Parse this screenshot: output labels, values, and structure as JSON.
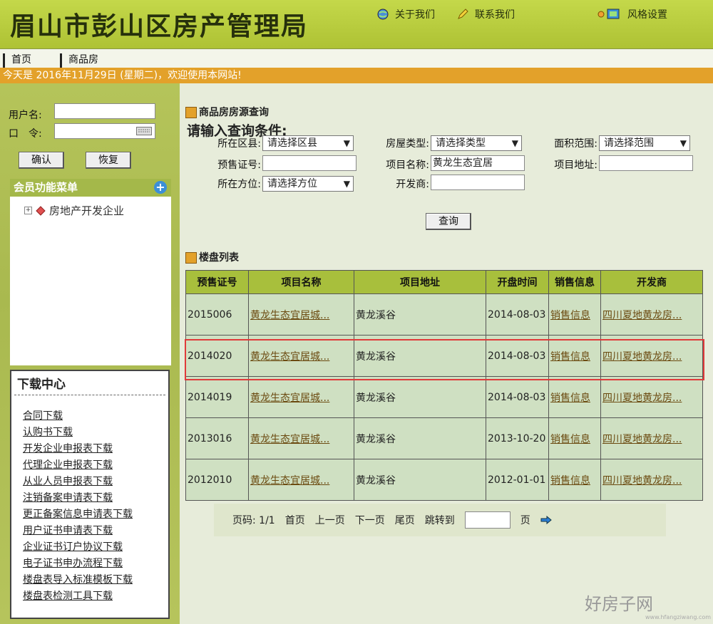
{
  "header": {
    "site_title": "眉山市彭山区房产管理局",
    "about": "关于我们",
    "contact": "联系我们",
    "style": "风格设置"
  },
  "nav": {
    "home": "首页",
    "commercial": "商品房"
  },
  "datebar": "今天是 2016年11月29日 (星期二)，欢迎使用本网站!",
  "login": {
    "username_label": "用户名:",
    "password_label": "口　令:",
    "confirm": "确认",
    "reset": "恢复"
  },
  "member": {
    "title": "会员功能菜单",
    "item": "房地产开发企业"
  },
  "downloads": {
    "title": "下载中心",
    "items": [
      "合同下载",
      "认购书下载",
      "开发企业申报表下载",
      "代理企业申报表下载",
      "从业人员申报表下载",
      "注销备案申请表下载",
      "更正备案信息申请表下载",
      "用户证书申请表下载",
      "企业证书订户协议下载",
      "电子证书申办流程下载",
      "楼盘表导入标准模板下载",
      "楼盘表检测工具下载"
    ]
  },
  "query": {
    "section_title": "商品房房源查询",
    "prompt": "请输入查询条件:",
    "district_label": "所在区县:",
    "district_value": "请选择区县",
    "type_label": "房屋类型:",
    "type_value": "请选择类型",
    "area_label": "面积范围:",
    "area_value": "请选择范围",
    "presale_label": "预售证号:",
    "presale_value": "",
    "project_label": "项目名称:",
    "project_value": "黄龙生态宜居",
    "address_label": "项目地址:",
    "address_value": "",
    "direction_label": "所在方位:",
    "direction_value": "请选择方位",
    "developer_label": "开发商:",
    "developer_value": "",
    "search_button": "查询"
  },
  "listing": {
    "section_title": "楼盘列表",
    "columns": [
      "预售证号",
      "项目名称",
      "项目地址",
      "开盘时间",
      "销售信息",
      "开发商"
    ],
    "rows": [
      [
        "2015006",
        "黄龙生态宜居城...",
        "黄龙溪谷",
        "2014-08-03",
        "销售信息",
        "四川夏地黄龙房..."
      ],
      [
        "2014020",
        "黄龙生态宜居城...",
        "黄龙溪谷",
        "2014-08-03",
        "销售信息",
        "四川夏地黄龙房..."
      ],
      [
        "2014019",
        "黄龙生态宜居城...",
        "黄龙溪谷",
        "2014-08-03",
        "销售信息",
        "四川夏地黄龙房..."
      ],
      [
        "2013016",
        "黄龙生态宜居城...",
        "黄龙溪谷",
        "2013-10-20",
        "销售信息",
        "四川夏地黄龙房..."
      ],
      [
        "2012010",
        "黄龙生态宜居城...",
        "黄龙溪谷",
        "2012-01-01",
        "销售信息",
        "四川夏地黄龙房..."
      ]
    ],
    "highlighted_row": 1
  },
  "pager": {
    "page_info": "页码: 1/1",
    "first": "首页",
    "prev": "上一页",
    "next": "下一页",
    "last": "尾页",
    "jump": "跳转到",
    "page_suffix": "页"
  },
  "watermark": {
    "text": "好房子网",
    "url": "www.hfangziwang.com"
  },
  "icons": {
    "about": "globe-icon",
    "contact": "pencil-icon",
    "style": "palette-icon",
    "go": "arrow-right-icon"
  },
  "colors": {
    "header": "#b7cc3c",
    "datebar": "#e3a12a",
    "table_header": "#a8bf3c",
    "highlight": "#e03a3a"
  }
}
